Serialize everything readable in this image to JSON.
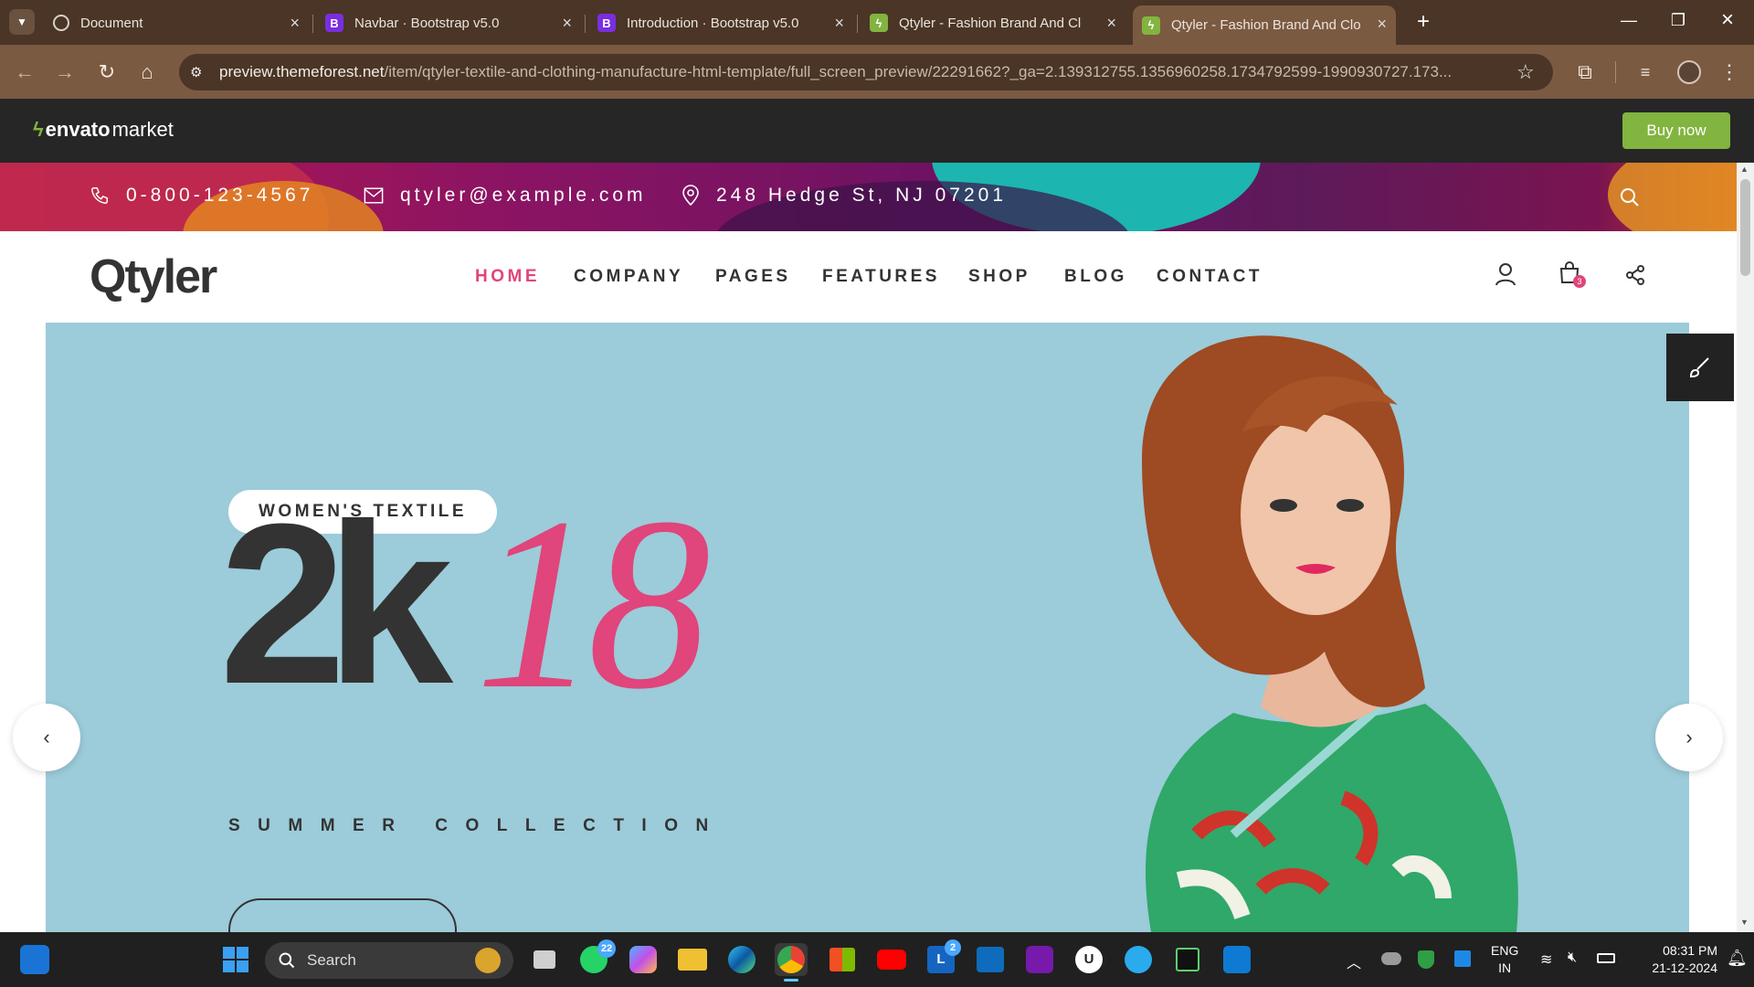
{
  "browser": {
    "tabs": [
      {
        "title": "Document",
        "icon": "globe-icon"
      },
      {
        "title": "Navbar · Bootstrap v5.0",
        "icon": "bootstrap-icon"
      },
      {
        "title": "Introduction · Bootstrap v5.0",
        "icon": "bootstrap-icon"
      },
      {
        "title": "Qtyler - Fashion Brand And Clo",
        "icon": "envato-icon"
      },
      {
        "title": "Qtyler - Fashion Brand And Clo",
        "icon": "envato-icon",
        "active": true
      }
    ],
    "url_host": "preview.themeforest.net",
    "url_path": "/item/qtyler-textile-and-clothing-manufacture-html-template/full_screen_preview/22291662?_ga=2.139312755.1356960258.1734792599-1990930727.173..."
  },
  "envato": {
    "logo_bold": "envato",
    "logo_light": "market",
    "buy_label": "Buy now",
    "buy_color": "#82b440"
  },
  "site": {
    "phone": "0-800-123-4567",
    "email": "qtyler@example.com",
    "address": "248 Hedge St, NJ 07201",
    "logo": "Qtyler",
    "nav": [
      "HOME",
      "COMPANY",
      "PAGES",
      "FEATURES",
      "SHOP",
      "BLOG",
      "CONTACT"
    ],
    "active_nav": "HOME",
    "accent": "#e0457b",
    "cart_count": "3"
  },
  "hero": {
    "tag": "WOMEN'S TEXTILE",
    "big_left": "2k",
    "big_right": "18",
    "subtitle": "SUMMER COLLECTION",
    "bg_color": "#9ccbd9"
  },
  "taskbar": {
    "search_placeholder": "Search",
    "whatsapp_badge": "22",
    "lens_badge": "2",
    "lang_top": "ENG",
    "lang_bottom": "IN",
    "time": "08:31 PM",
    "date": "21-12-2024"
  }
}
